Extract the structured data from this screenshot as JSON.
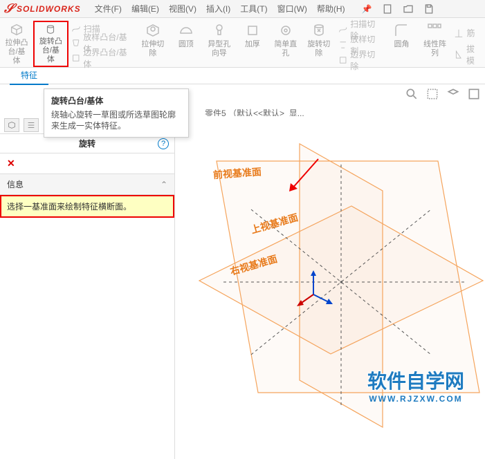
{
  "app": {
    "name": "SOLIDWORKS"
  },
  "menu": {
    "file": "文件(F)",
    "edit": "编辑(E)",
    "view": "视图(V)",
    "insert": "插入(I)",
    "tools": "工具(T)",
    "window": "窗口(W)",
    "help": "帮助(H)"
  },
  "ribbon": {
    "extrude": "拉伸凸\n台/基体",
    "revolve": "旋转凸\n台/基体",
    "sweep": "扫描",
    "loft": "放样凸台/基体",
    "boundary": "边界凸台/基体",
    "extrude_cut": "拉伸切\n除",
    "hole_wizard": "异型孔\n向导",
    "revolve_cut": "旋转切\n除",
    "sweep_cut": "扫描切除",
    "loft_cut": "放样切割",
    "boundary_cut": "边界切除",
    "fillet": "圆角",
    "linear_pattern": "线性阵\n列",
    "rib": "筋",
    "draft": "拔模",
    "dome": "圆顶",
    "thicken": "加厚",
    "simple_hole": "简单直\n孔"
  },
  "tabs": {
    "features": "特征"
  },
  "tooltip": {
    "title": "旋转凸台/基体",
    "body": "绕轴心旋转一草图或所选草图轮廓来生成一实体特征。"
  },
  "doc": {
    "title": "零件5 （默认<<默认>_显..."
  },
  "panel": {
    "title": "旋转",
    "close": "✕",
    "section": "信息",
    "info_text": "选择一基准面来绘制特征横断面。"
  },
  "planes": {
    "front": "前视基准面",
    "top": "上视基准面",
    "right": "右视基准面"
  },
  "watermark": {
    "zh": "软件自学网",
    "en": "WWW.RJZXW.COM"
  }
}
